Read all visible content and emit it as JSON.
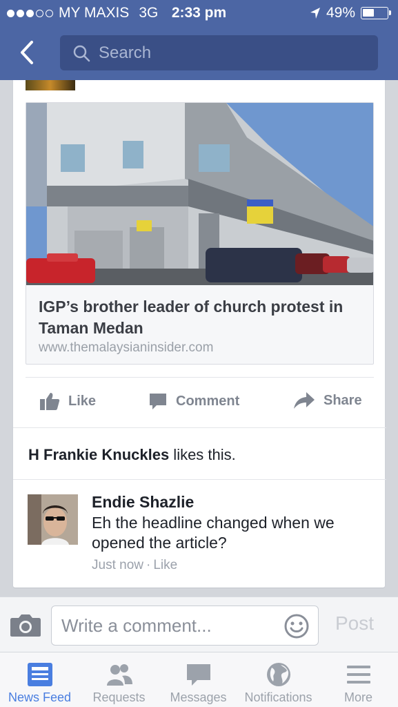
{
  "status_bar": {
    "carrier": "MY MAXIS",
    "network": "3G",
    "time": "2:33 pm",
    "battery": "49%",
    "battery_level": 0.49,
    "signal_bars_filled": 3,
    "signal_bars_total": 5
  },
  "search": {
    "placeholder": "Search"
  },
  "post": {
    "link_preview": {
      "title": "IGP’s brother leader of church protest in Taman Medan",
      "url": "www.themalaysianinsider.com"
    },
    "actions": {
      "like": "Like",
      "comment": "Comment",
      "share": "Share"
    },
    "likes": {
      "name": "H Frankie Knuckles",
      "suffix": " likes this."
    },
    "comment": {
      "author": "Endie Shazlie",
      "text": "Eh the headline changed when we opened the article?",
      "time": "Just now",
      "separator": "·",
      "like": "Like"
    }
  },
  "composer": {
    "placeholder": "Write a comment...",
    "post_label": "Post"
  },
  "tabbar": {
    "tabs": [
      {
        "label": "News Feed"
      },
      {
        "label": "Requests"
      },
      {
        "label": "Messages"
      },
      {
        "label": "Notifications"
      },
      {
        "label": "More"
      }
    ]
  },
  "colors": {
    "header": "#4c66a4",
    "active_tab": "#4a7ee0",
    "inactive": "#9ca2ab"
  }
}
